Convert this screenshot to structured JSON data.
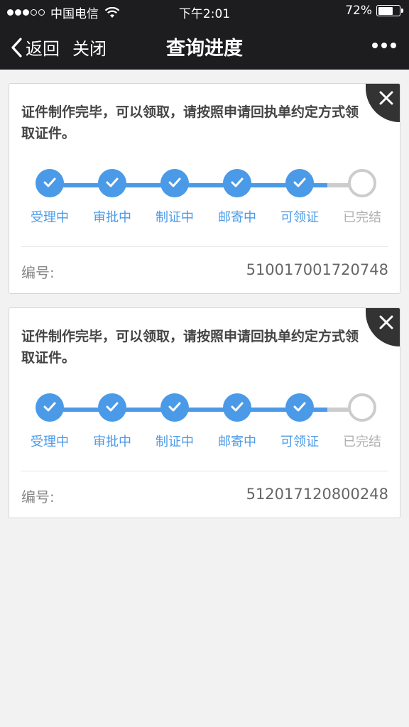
{
  "status_bar": {
    "carrier": "中国电信",
    "time": "下午2:01",
    "battery": "72%",
    "battery_level": 0.72,
    "signal_bars": 3
  },
  "nav": {
    "back": "返回",
    "close": "关闭",
    "title": "查询进度"
  },
  "colors": {
    "accent": "#4a9ae8",
    "pending": "#cccccc",
    "nav_bg": "#1d1d1f",
    "page_bg": "#f2f2f2"
  },
  "cards": [
    {
      "message": "证件制作完毕，可以领取，请按照申请回执单约定方式领取证件。",
      "steps": [
        {
          "label": "受理中",
          "done": true
        },
        {
          "label": "审批中",
          "done": true
        },
        {
          "label": "制证中",
          "done": true
        },
        {
          "label": "邮寄中",
          "done": true
        },
        {
          "label": "可领证",
          "done": true
        },
        {
          "label": "已完结",
          "done": false
        }
      ],
      "number_label": "编号:",
      "number": "510017001720748"
    },
    {
      "message": "证件制作完毕，可以领取，请按照申请回执单约定方式领取证件。",
      "steps": [
        {
          "label": "受理中",
          "done": true
        },
        {
          "label": "审批中",
          "done": true
        },
        {
          "label": "制证中",
          "done": true
        },
        {
          "label": "邮寄中",
          "done": true
        },
        {
          "label": "可领证",
          "done": true
        },
        {
          "label": "已完结",
          "done": false
        }
      ],
      "number_label": "编号:",
      "number": "512017120800248"
    }
  ]
}
